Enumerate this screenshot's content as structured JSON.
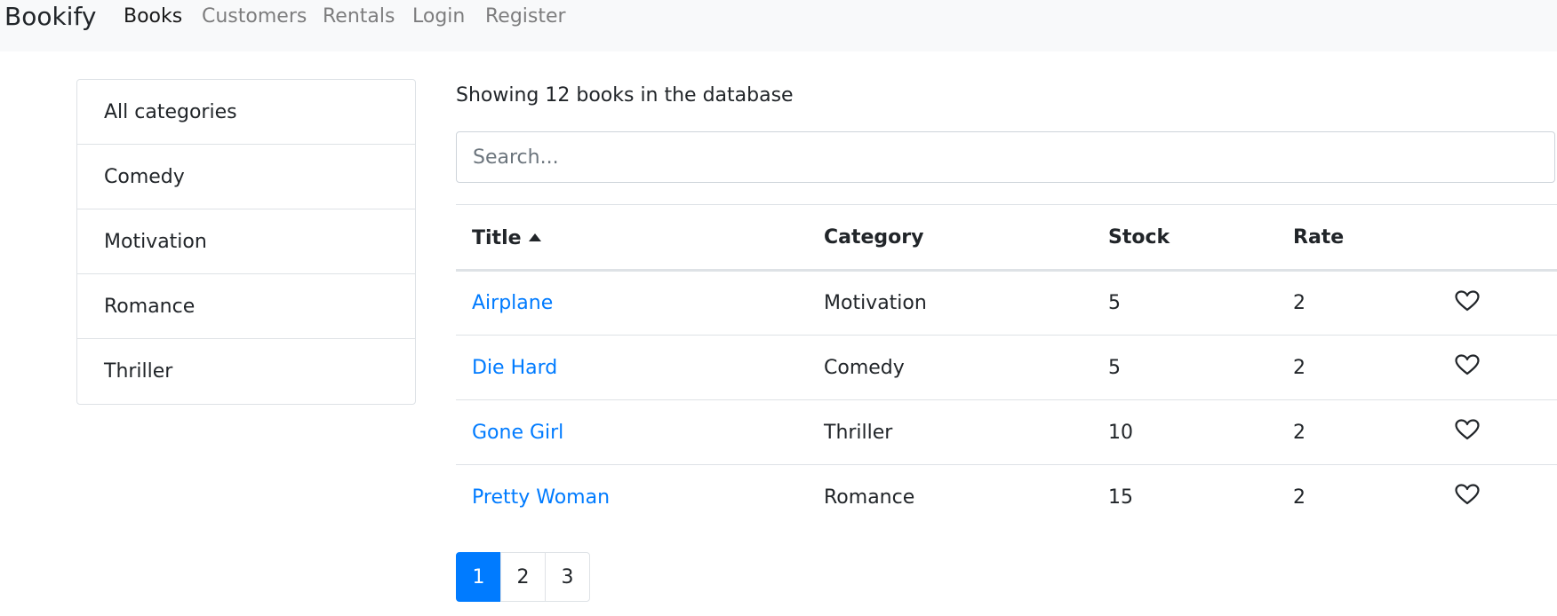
{
  "navbar": {
    "brand": "Bookify",
    "links": [
      "Books",
      "Customers",
      "Rentals",
      "Login",
      "Register"
    ]
  },
  "sidebar": {
    "categories": [
      "All categories",
      "Comedy",
      "Motivation",
      "Romance",
      "Thriller"
    ]
  },
  "main": {
    "summary": "Showing 12 books in the database",
    "search_placeholder": "Search...",
    "table": {
      "headers": [
        "Title",
        "Category",
        "Stock",
        "Rate"
      ],
      "sort_icon": "caret-up-icon",
      "row_icon": "heart-icon",
      "rows": [
        [
          "Airplane",
          "Motivation",
          "5",
          "2"
        ],
        [
          "Die Hard",
          "Comedy",
          "5",
          "2"
        ],
        [
          "Gone Girl",
          "Thriller",
          "10",
          "2"
        ],
        [
          "Pretty Woman",
          "Romance",
          "15",
          "2"
        ]
      ]
    },
    "pagination": [
      "1",
      "2",
      "3"
    ],
    "pagination_active": "1"
  },
  "colors": {
    "link": "#007bff",
    "active_page": "#007bff",
    "navbar_bg": "#f8f9fa",
    "border": "#dee2e6"
  }
}
